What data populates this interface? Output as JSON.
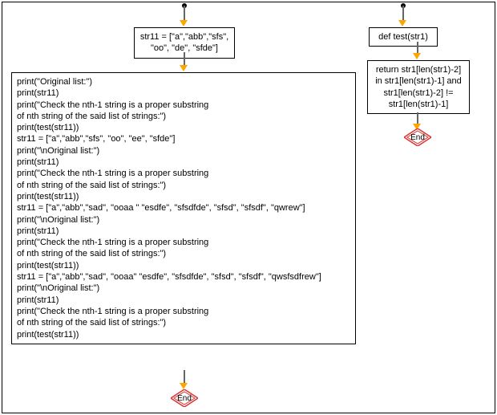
{
  "chart_data": {
    "type": "flowchart",
    "nodes": [
      {
        "id": "assign1",
        "type": "process",
        "text": "str11 = [\"a\",\"abb\",\"sfs\",\n\"oo\", \"de\", \"sfde\"]"
      },
      {
        "id": "main-block",
        "type": "process",
        "lines": [
          "print(\"Original list:\")",
          "print(str11)",
          "print(\"Check the nth-1 string is a proper substring",
          "of nth string of the said list of strings:\")",
          "print(test(str11))",
          "str11 = [\"a\",\"abb\",\"sfs\", \"oo\", \"ee\", \"sfde\"]",
          "print(\"\\nOriginal list:\")",
          "print(str11)",
          "print(\"Check the nth-1 string is a proper substring",
          "of nth string of the said list of strings:\")",
          "print(test(str11))",
          "str11 = [\"a\",\"abb\",\"sad\", \"ooaa \" \"esdfe\", \"sfsdfde\", \"sfsd\", \"sfsdf\", \"qwrew\"]",
          "print(\"\\nOriginal list:\")",
          "print(str11)",
          "print(\"Check the nth-1 string is a proper substring",
          "of nth string of the said list of strings:\")",
          "print(test(str11))",
          "str11 = [\"a\",\"abb\",\"sad\", \"ooaa\" \"esdfe\", \"sfsdfde\", \"sfsd\", \"sfsdf\", \"qwsfsdfrew\"]",
          "print(\"\\nOriginal list:\")",
          "print(str11)",
          "print(\"Check the nth-1 string is a proper substring",
          "of nth string of the said list of strings:\")",
          "print(test(str11))"
        ]
      },
      {
        "id": "def-test",
        "type": "process",
        "text": "def test(str1)"
      },
      {
        "id": "return-block",
        "type": "process",
        "text": "return str1[len(str1)-2]\nin str1[len(str1)-1] and\nstr1[len(str1)-2] !=\nstr1[len(str1)-1]"
      },
      {
        "id": "end1",
        "type": "terminator",
        "text": "End"
      },
      {
        "id": "end2",
        "type": "terminator",
        "text": "End"
      }
    ],
    "edges": [
      {
        "from": "start1",
        "to": "assign1"
      },
      {
        "from": "assign1",
        "to": "main-block"
      },
      {
        "from": "main-block",
        "to": "end1"
      },
      {
        "from": "start2",
        "to": "def-test"
      },
      {
        "from": "def-test",
        "to": "return-block"
      },
      {
        "from": "return-block",
        "to": "end2"
      }
    ]
  },
  "box1": {
    "line1": "str11 = [\"a\",\"abb\",\"sfs\",",
    "line2": "\"oo\", \"de\", \"sfde\"]"
  },
  "box2": {
    "l1": "print(\"Original list:\")",
    "l2": "print(str11)",
    "l3": "print(\"Check the nth-1 string is a proper substring",
    "l4": "of nth string of the said list of strings:\")",
    "l5": "print(test(str11))",
    "l6": "str11 = [\"a\",\"abb\",\"sfs\", \"oo\", \"ee\", \"sfde\"]",
    "l7": "print(\"\\nOriginal list:\")",
    "l8": "print(str11)",
    "l9": "print(\"Check the nth-1 string is a proper substring",
    "l10": "of nth string of the said list of strings:\")",
    "l11": "print(test(str11))",
    "l12": "str11 = [\"a\",\"abb\",\"sad\", \"ooaa \" \"esdfe\", \"sfsdfde\", \"sfsd\", \"sfsdf\", \"qwrew\"]",
    "l13": "print(\"\\nOriginal list:\")",
    "l14": "print(str11)",
    "l15": "print(\"Check the nth-1 string is a proper substring",
    "l16": "of nth string of the said list of strings:\")",
    "l17": "print(test(str11))",
    "l18": "str11 = [\"a\",\"abb\",\"sad\", \"ooaa\" \"esdfe\", \"sfsdfde\", \"sfsd\", \"sfsdf\", \"qwsfsdfrew\"]",
    "l19": "print(\"\\nOriginal list:\")",
    "l20": "print(str11)",
    "l21": "print(\"Check the nth-1 string is a proper substring",
    "l22": "of nth string of the said list of strings:\")",
    "l23": "print(test(str11))"
  },
  "box3": {
    "line1": "def test(str1)"
  },
  "box4": {
    "line1": "return str1[len(str1)-2]",
    "line2": "in str1[len(str1)-1] and",
    "line3": "str1[len(str1)-2] !=",
    "line4": "str1[len(str1)-1]"
  },
  "end_label": "End"
}
